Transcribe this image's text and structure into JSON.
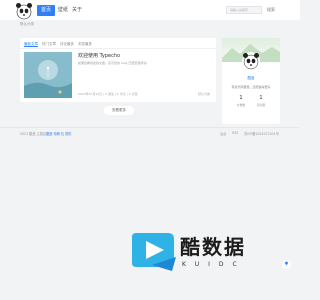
{
  "header": {
    "nav": [
      "首页",
      "壁纸",
      "关于"
    ],
    "search_placeholder": "请输入关键字",
    "search_label": "搜索"
  },
  "breadcrumb": "默认分类",
  "main": {
    "tabs": [
      "最新文章",
      "热门文章",
      "评论最多",
      "浏览最多"
    ],
    "post": {
      "title": "欢迎使用 Typecho",
      "excerpt": "如果您看到这篇文章，表示您的 blog 已经安装成功.",
      "meta": "2024年07月12日 | 0 阅读 | 0 评论 | 0 点赞",
      "category": "默认分类"
    },
    "more_button": "查看更多"
  },
  "sidebar": {
    "name": "酷盘",
    "description": "有些代码要懂，还能做得更好",
    "stats": [
      {
        "value": "1",
        "label": "文章数"
      },
      {
        "value": "1",
        "label": "评论量"
      }
    ]
  },
  "footer": {
    "copyright": "2024 ",
    "site": "酷盘",
    "powered_prefix": " 主题由",
    "powered_link": "酷盘 特辑 社 提供",
    "links": [
      "后台",
      "RSS",
      "酷盘"
    ],
    "icp": "苏ICP备2024071001号"
  },
  "watermark": {
    "text": "酷数据",
    "sub": "KUIDC"
  },
  "colors": {
    "accent": "#2f7ff6",
    "background": "#f2f3f5"
  }
}
